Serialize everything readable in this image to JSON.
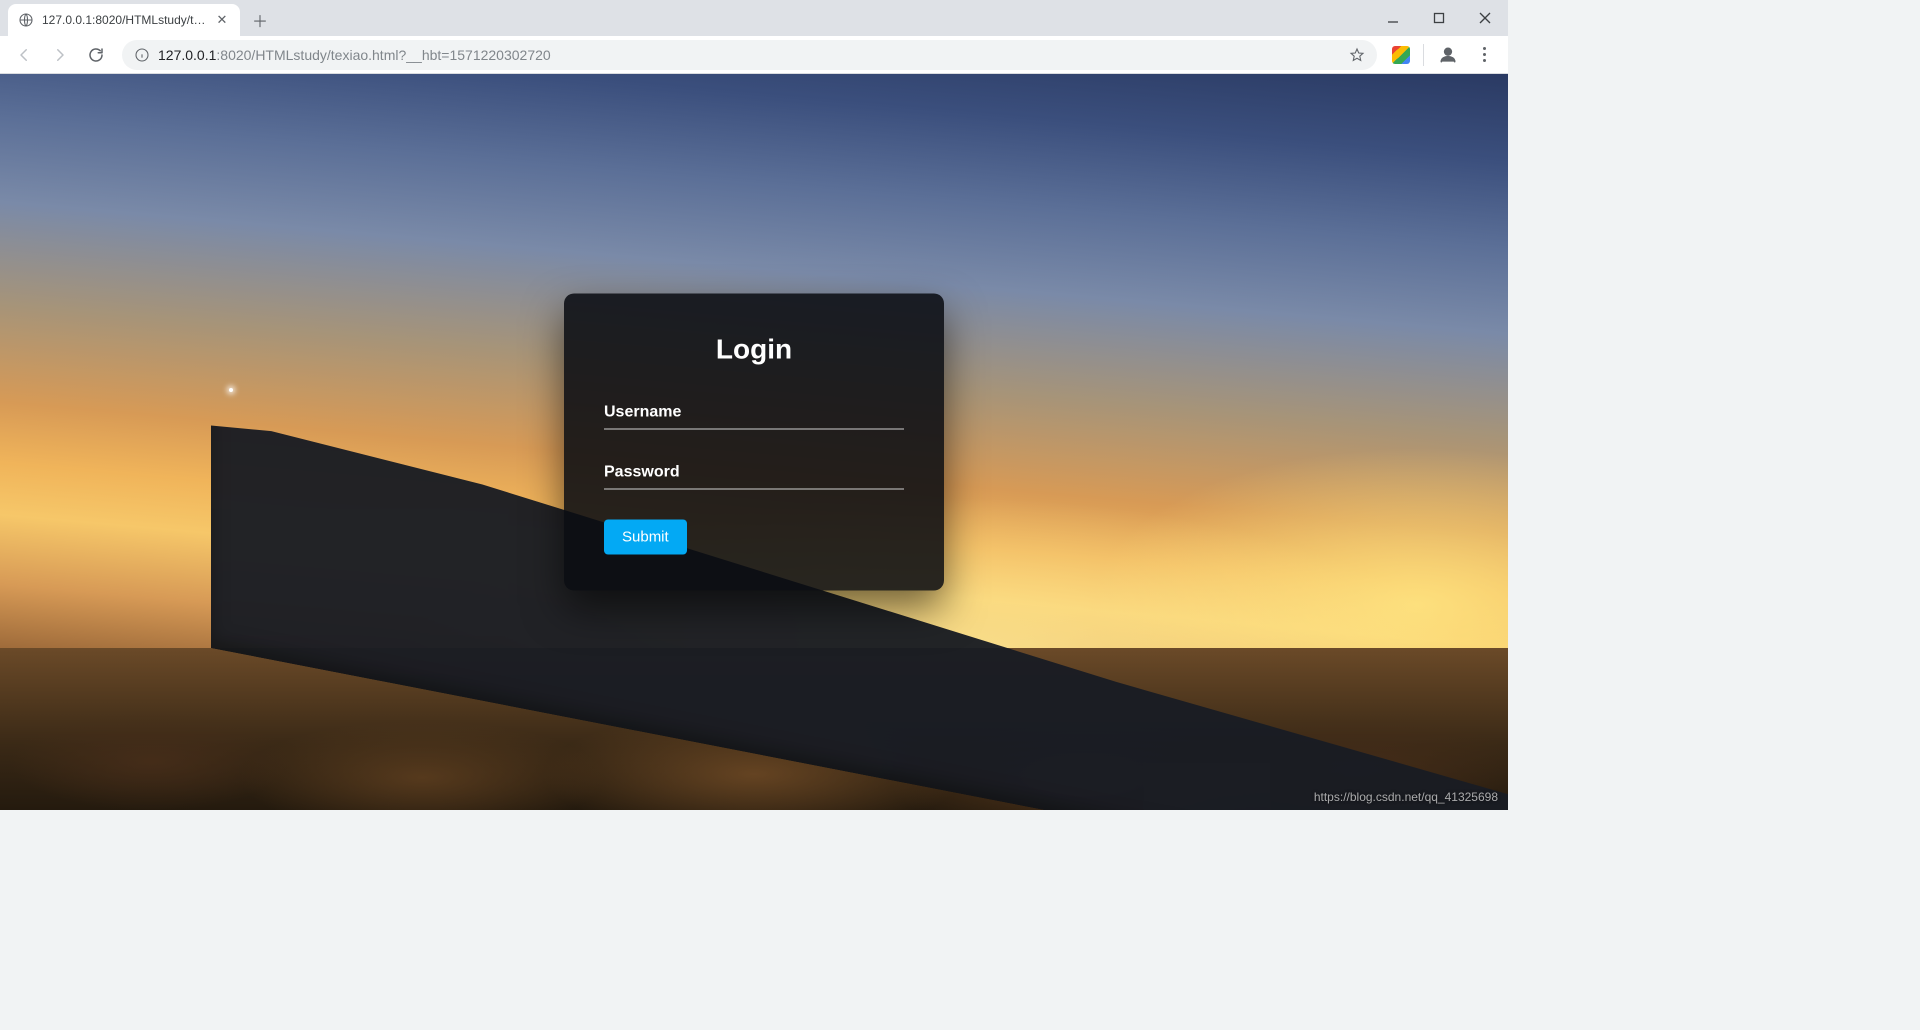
{
  "browser": {
    "tab": {
      "title": "127.0.0.1:8020/HTMLstudy/tex"
    },
    "address": {
      "host": "127.0.0.1",
      "rest": ":8020/HTMLstudy/texiao.html?__hbt=1571220302720"
    }
  },
  "login": {
    "title": "Login",
    "username_label": "Username",
    "username_value": "",
    "password_label": "Password",
    "password_value": "",
    "submit_label": "Submit"
  },
  "watermark": "https://blog.csdn.net/qq_41325698",
  "colors": {
    "accent": "#03a9f4",
    "card_bg": "rgba(10,12,18,0.88)"
  }
}
